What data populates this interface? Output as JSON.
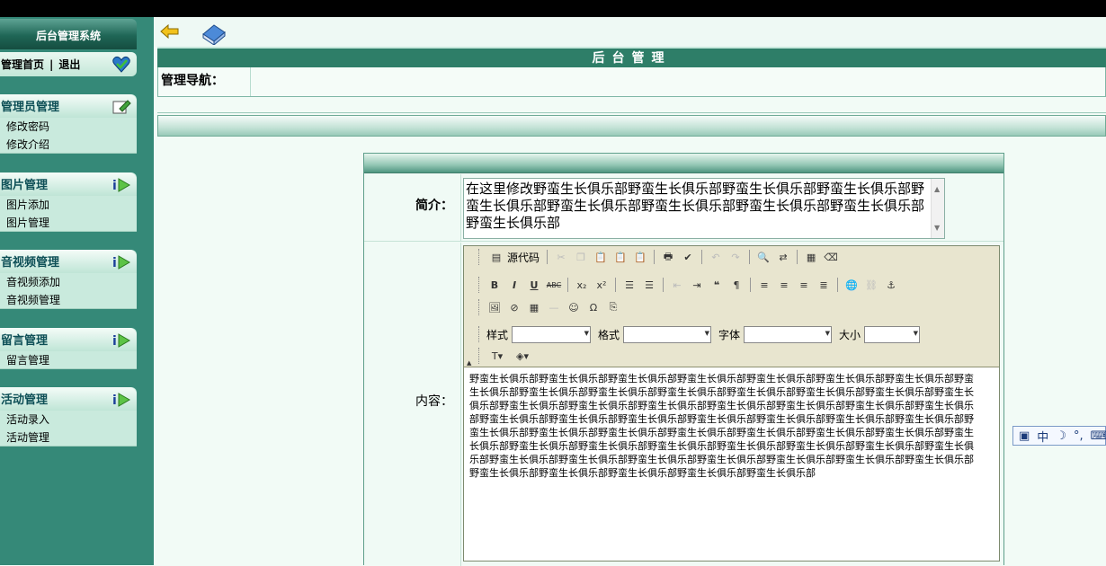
{
  "sidebar": {
    "title": "后台管理系统",
    "home_label": "管理首页",
    "separator": "|",
    "logout_label": "退出",
    "groups": [
      {
        "title": "管理员管理",
        "items": [
          "修改密码",
          "修改介绍"
        ]
      },
      {
        "title": "图片管理",
        "items": [
          "图片添加",
          "图片管理"
        ]
      },
      {
        "title": "音视频管理",
        "items": [
          "音视频添加",
          "音视频管理"
        ]
      },
      {
        "title": "留言管理",
        "items": [
          "留言管理"
        ]
      },
      {
        "title": "活动管理",
        "items": [
          "活动录入",
          "活动管理"
        ]
      }
    ]
  },
  "main": {
    "header_title": "后台管理",
    "nav_label": "管理导航："
  },
  "form": {
    "intro_label": "简介：",
    "intro_value": "在这里修改野蛮生长俱乐部野蛮生长俱乐部野蛮生长俱乐部野蛮生长俱乐部野蛮生长俱乐部野蛮生长俱乐部野蛮生长俱乐部野蛮生长俱乐部野蛮生长俱乐部野蛮生长俱乐部",
    "content_label": "内容：",
    "content_value": "野蛮生长俱乐部野蛮生长俱乐部野蛮生长俱乐部野蛮生长俱乐部野蛮生长俱乐部野蛮生长俱乐部野蛮生长俱乐部野蛮生长俱乐部野蛮生长俱乐部野蛮生长俱乐部野蛮生长俱乐部野蛮生长俱乐部野蛮生长俱乐部野蛮生长俱乐部野蛮生长俱乐部野蛮生长俱乐部野蛮生长俱乐部野蛮生长俱乐部野蛮生长俱乐部野蛮生长俱乐部野蛮生长俱乐部野蛮生长俱乐部野蛮生长俱乐部野蛮生长俱乐部野蛮生长俱乐部野蛮生长俱乐部野蛮生长俱乐部野蛮生长俱乐部野蛮生长俱乐部野蛮生长俱乐部野蛮生长俱乐部野蛮生长俱乐部野蛮生长俱乐部野蛮生长俱乐部野蛮生长俱乐部野蛮生长俱乐部野蛮生长俱乐部野蛮生长俱乐部野蛮生长俱乐部野蛮生长俱乐部野蛮生长俱乐部野蛮生长俱乐部野蛮生长俱乐部野蛮生长俱乐部野蛮生长俱乐部野蛮生长俱乐部野蛮生长俱乐部野蛮生长俱乐部野蛮生长俱乐部野蛮生长俱乐部野蛮生长俱乐部野蛮生长俱乐部野蛮生长俱乐部野蛮生长俱乐部野蛮生长俱乐部野蛮生长俱乐部"
  },
  "editor": {
    "source_label": "源代码",
    "style_label": "样式",
    "format_label": "格式",
    "font_label": "字体",
    "size_label": "大小",
    "style_value": "",
    "format_value": "",
    "font_value": "",
    "size_value": ""
  },
  "ime": {
    "mode": "中"
  },
  "colors": {
    "sidebar_bg": "#358978",
    "header_bg": "#2e7e68",
    "page_bg": "#f2fbf6",
    "group_title": "#0d4f56"
  },
  "icons": [
    "back-arrow-icon",
    "book-icon",
    "heart-icon",
    "edit-note-icon",
    "i-logo-icon"
  ]
}
